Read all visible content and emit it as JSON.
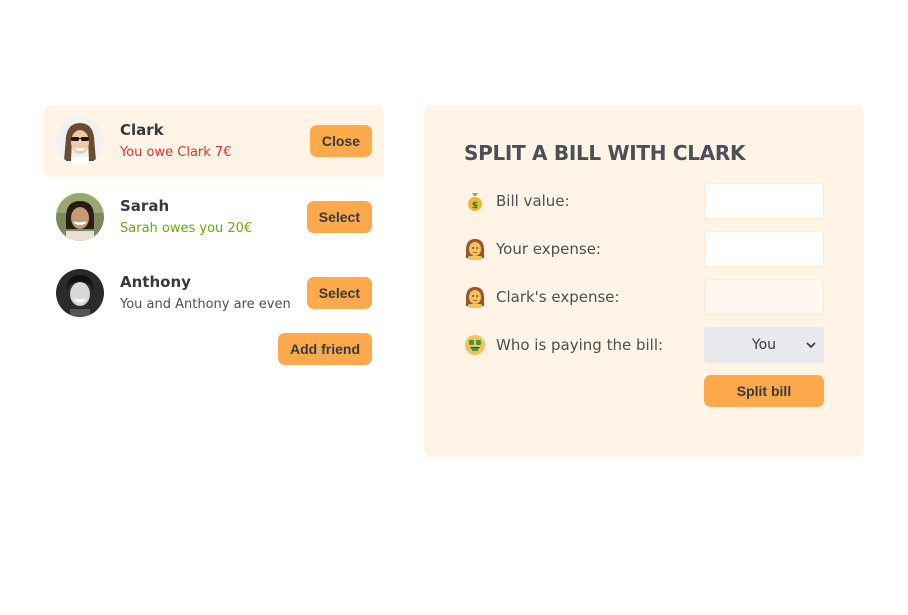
{
  "friends": [
    {
      "name": "Clark",
      "balance": "You owe Clark 7€",
      "button": "Close",
      "avatar": "clark-avatar"
    },
    {
      "name": "Sarah",
      "balance": "Sarah owes you 20€",
      "button": "Select",
      "avatar": "sarah-avatar"
    },
    {
      "name": "Anthony",
      "balance": "You and Anthony are even",
      "button": "Select",
      "avatar": "anthony-avatar"
    }
  ],
  "add_friend_label": "Add friend",
  "split_form": {
    "title": "SPLIT A BILL WITH CLARK",
    "bill_value_label": "Bill value:",
    "your_expense_label": "Your expense:",
    "friend_expense_label": "Clark's expense:",
    "payer_label": "Who is paying the bill:",
    "payer_selected": "You",
    "submit_label": "Split bill",
    "bill_value": "",
    "your_expense": "",
    "friend_expense": ""
  },
  "icons": {
    "bill_value": "money-bag-icon",
    "your_expense": "woman-icon",
    "friend_expense": "woman-icon",
    "payer": "money-mouth-face-icon"
  },
  "colors": {
    "accent": "#ffa94d",
    "panel_bg": "#fff4e6",
    "owe_red": "#e03131",
    "owed_green": "#66a80f"
  }
}
